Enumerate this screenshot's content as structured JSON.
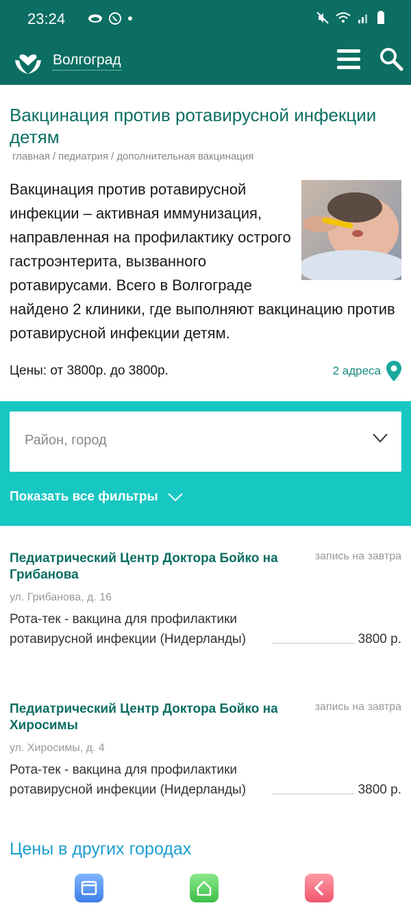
{
  "statusbar": {
    "time": "23:24"
  },
  "header": {
    "city": "Волгоград"
  },
  "page": {
    "title": "Вакцинация против ротавирусной инфекции детям",
    "breadcrumbs": [
      "главная",
      "педиатрия",
      "дополнительная вакцинация"
    ],
    "intro": "Вакцинация против ротавирусной инфекции – активная иммунизация, направленная на профилактику острого гастроэнтерита, вызванного ротавирусами. Всего в Волгограде найдено 2 клиники, где выполняют вакцинацию против ротавирусной инфекции детям.",
    "prices": "Цены: от 3800р. до 3800р.",
    "addresses": "2 адреса"
  },
  "filters": {
    "district_placeholder": "Район, город",
    "show_all": "Показать все фильтры"
  },
  "clinics": [
    {
      "name": "Педиатрический Центр Доктора Бойко на Грибанова",
      "booking": "запись на завтра",
      "street": "ул. Грибанова, д. 16",
      "service": "Рота-тек - вакцина для профилактики ротавирусной инфекции (Нидерланды)",
      "price": "3800 р."
    },
    {
      "name": "Педиатрический Центр Доктора Бойко на Хиросимы",
      "booking": "запись на завтра",
      "street": "ул. Хиросимы, д. 4",
      "service": "Рота-тек - вакцина для профилактики ротавирусной инфекции (Нидерланды)",
      "price": "3800 р."
    }
  ],
  "other_cities": "Цены в других городах",
  "colors": {
    "brand": "#0c6e63",
    "accent": "#17c7c2",
    "link": "#1a9ed0"
  }
}
